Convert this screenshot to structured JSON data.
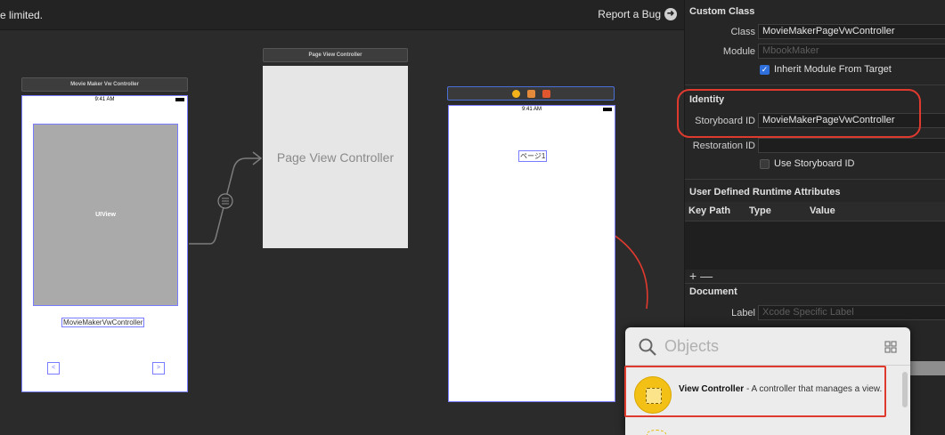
{
  "canvas": {
    "top_message": "e limited.",
    "report_bug": "Report a Bug",
    "scene1": {
      "title": "Movie Maker Vw Controller",
      "time": "9:41 AM",
      "uiview_label": "UIView",
      "class_label": "MovieMakerVwController",
      "prev_glyph": "<",
      "next_glyph": ">"
    },
    "scene2": {
      "title": "Page View Controller",
      "body_label": "Page View Controller"
    },
    "scene3": {
      "time": "9:41 AM",
      "page_label": "ページ1"
    }
  },
  "inspector": {
    "custom_class": {
      "title": "Custom Class",
      "class_label": "Class",
      "class_value": "MovieMakerPageVwController",
      "module_label": "Module",
      "module_placeholder": "MbookMaker",
      "inherit_label": "Inherit Module From Target"
    },
    "identity": {
      "title": "Identity",
      "storyboard_id_label": "Storyboard ID",
      "storyboard_id_value": "MovieMakerPageVwController",
      "restoration_id_label": "Restoration ID",
      "restoration_id_value": "",
      "use_storyboard_id_label": "Use Storyboard ID"
    },
    "runtime_attributes": {
      "title": "User Defined Runtime Attributes",
      "columns": [
        "Key Path",
        "Type",
        "Value"
      ],
      "add_remove": "+ —"
    },
    "document": {
      "title": "Document",
      "label_label": "Label",
      "label_placeholder": "Xcode Specific Label"
    }
  },
  "objects_panel": {
    "search_placeholder": "Objects",
    "item": {
      "name": "View Controller",
      "description": " - A controller that manages a view."
    }
  },
  "colors": {
    "annotation_red": "#e03a2f",
    "selection_blue": "#7a7cff",
    "checkbox_blue": "#2f6fdc"
  }
}
